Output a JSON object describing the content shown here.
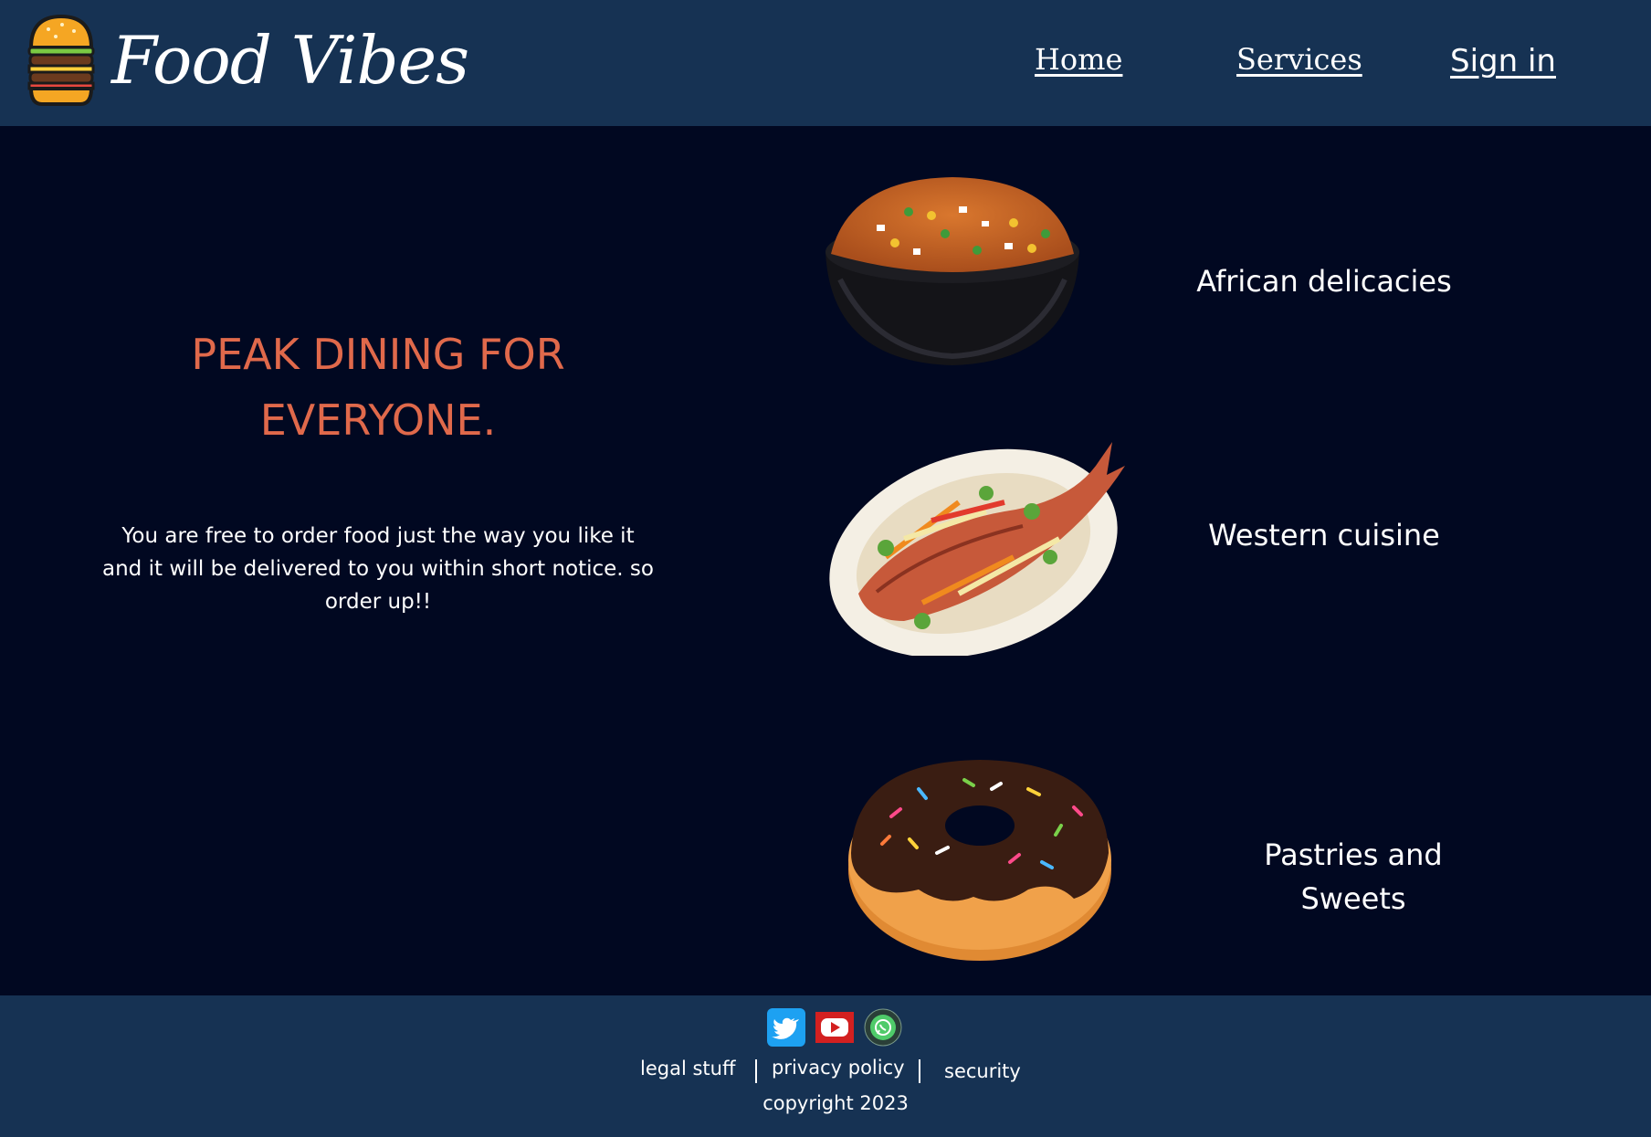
{
  "header": {
    "brand": "Food Vibes",
    "nav": {
      "home": "Home",
      "services": "Services",
      "sign_in": "Sign in"
    }
  },
  "hero": {
    "title": "PEAK DINING FOR EVERYONE.",
    "text": "You are free to order food just the way you like it and it will be delivered to you within short notice. so order up!!"
  },
  "categories": [
    {
      "label": "African  delicacies",
      "image": "jollof-rice-bowl"
    },
    {
      "label": "Western cuisine",
      "image": "grilled-fish-plate"
    },
    {
      "label": "Pastries and\nSweets",
      "image": "chocolate-donut"
    }
  ],
  "footer": {
    "social": [
      "twitter-icon",
      "youtube-icon",
      "whatsapp-icon"
    ],
    "links": {
      "legal": "legal stuff",
      "privacy": "privacy policy",
      "security": "security"
    },
    "copyright": "copyright 2023"
  },
  "colors": {
    "header_bg": "#163253",
    "page_bg": "#010821",
    "accent": "#e0694b"
  }
}
